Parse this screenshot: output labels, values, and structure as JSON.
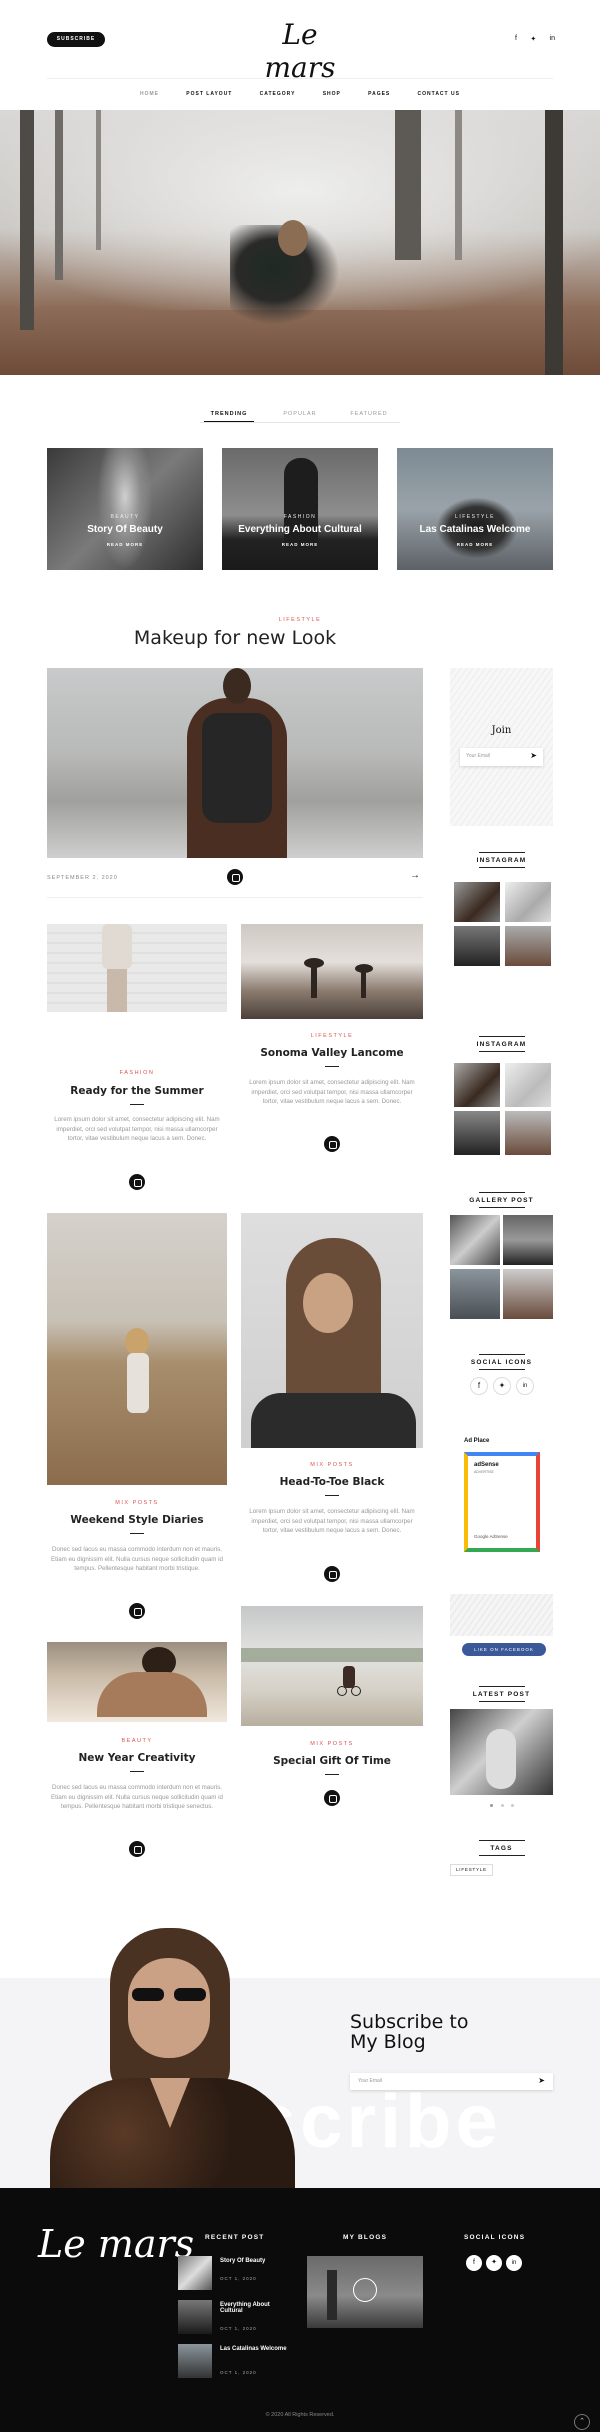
{
  "header": {
    "subscribe": "SUBSCRIBE",
    "logo": "Le mars",
    "social": [
      "f",
      "✦",
      "in"
    ]
  },
  "nav": [
    "HOME",
    "POST LAYOUT",
    "CATEGORY",
    "SHOP",
    "PAGES",
    "CONTACT US"
  ],
  "tabs": [
    "TRENDING",
    "POPULAR",
    "FEATURED"
  ],
  "cards": [
    {
      "cat": "BEAUTY",
      "title": "Story Of Beauty",
      "more": "READ MORE"
    },
    {
      "cat": "FASHION",
      "title": "Everything About Cultural",
      "more": "READ MORE"
    },
    {
      "cat": "LIFESTYLE",
      "title": "Las Catalinas Welcome",
      "more": "READ MORE"
    }
  ],
  "featured": {
    "cat": "LIFESTYLE",
    "title": "Makeup for new Look",
    "date": "SEPTEMBER 2, 2020"
  },
  "posts": [
    {
      "cat": "FASHION",
      "title": "Ready for the Summer",
      "desc": "Lorem ipsum dolor sit amet, consectetur adipiscing elit. Nam imperdiet, orci sed volutpat tempor, nisi massa ullamcorper tortor, vitae vestibulum neque lacus a sem. Donec."
    },
    {
      "cat": "LIFESTYLE",
      "title": "Sonoma Valley Lancome",
      "desc": "Lorem ipsum dolor sit amet, consectetur adipiscing elit. Nam imperdiet, orci sed volutpat tempor, nisi massa ullamcorper tortor, vitae vestibulum neque lacus a sem. Donec."
    },
    {
      "cat": "MIX POSTS",
      "title": "Weekend Style Diaries",
      "desc": "Donec sed lacus eu massa commodo interdum non et mauris. Etiam eu dignissim elit. Nulla cursus neque sollicitudin quam id tempus. Pellentesque habitant morbi tristique."
    },
    {
      "cat": "MIX POSTS",
      "title": "Head-To-Toe Black",
      "desc": "Lorem ipsum dolor sit amet, consectetur adipiscing elit. Nam imperdiet, orci sed volutpat tempor, nisi massa ullamcorper tortor, vitae vestibulum neque lacus a sem. Donec."
    },
    {
      "cat": "BEAUTY",
      "title": "New Year Creativity",
      "desc": "Donec sed lacus eu massa commodo interdum non et mauris. Etiam eu dignissim elit. Nulla cursus neque sollicitudin quam id tempus. Pellentesque habitant morbi tristique senectus."
    },
    {
      "cat": "MIX POSTS",
      "title": "Special Gift Of Time"
    }
  ],
  "sidebar": {
    "join": "Join",
    "email_ph": "Your Email",
    "instagram": "INSTAGRAM",
    "gallery": "GALLERY POST",
    "social": "SOCIAL ICONS",
    "ad": "Ad Place",
    "adsense": "adSense",
    "adsense_sub": "ADVERTISE",
    "google": "Google AdSense",
    "like_fb": "LIKE ON FACEBOOK",
    "latest": "LATEST POST",
    "tags": "TAGS",
    "tag1": "LIFESTYLE"
  },
  "subscribe": {
    "title": "Subscribe to My Blog",
    "email_ph": "Your Email",
    "bg_word": "Subscribe"
  },
  "footer": {
    "logo": "Le mars",
    "recent": "RECENT POST",
    "blogs": "MY BLOGS",
    "social": "SOCIAL ICONS",
    "items": [
      {
        "title": "Story Of Beauty",
        "date": "OCT 1, 2020"
      },
      {
        "title": "Everything About Cultural",
        "date": "OCT 1, 2020"
      },
      {
        "title": "Las Catalinas Welcome",
        "date": "OCT 1, 2020"
      }
    ],
    "copyright": "© 2020 All Rights Reserved."
  },
  "colors": {
    "accent": "#d9534f",
    "dark": "#111111",
    "footer": "#0c0b0b"
  }
}
